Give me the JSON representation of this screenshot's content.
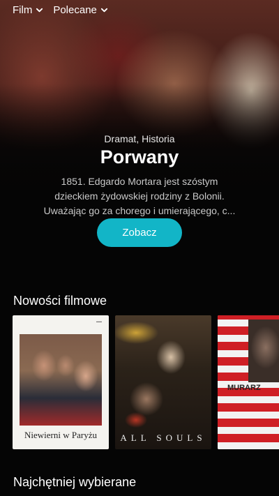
{
  "nav": {
    "items": [
      {
        "label": "Film",
        "icon": "chevron-down-icon"
      },
      {
        "label": "Polecane",
        "icon": "chevron-down-icon"
      }
    ]
  },
  "hero": {
    "genres": "Dramat, Historia",
    "title": "Porwany",
    "description_lines": [
      "1851. Edgardo Mortara jest szóstym",
      "dzieckiem żydowskiej rodziny z Bolonii.",
      "Uważając go za chorego i umierającego, c..."
    ],
    "cta_label": "Zobacz",
    "cta_color": "#12b5c7"
  },
  "sections": [
    {
      "title": "Nowości filmowe",
      "posters": [
        {
          "caption": "Niewierni w Paryżu"
        },
        {
          "caption": "ALL SOULS"
        },
        {
          "caption": "MURARZ"
        }
      ]
    },
    {
      "title": "Najchętniej wybierane"
    }
  ]
}
